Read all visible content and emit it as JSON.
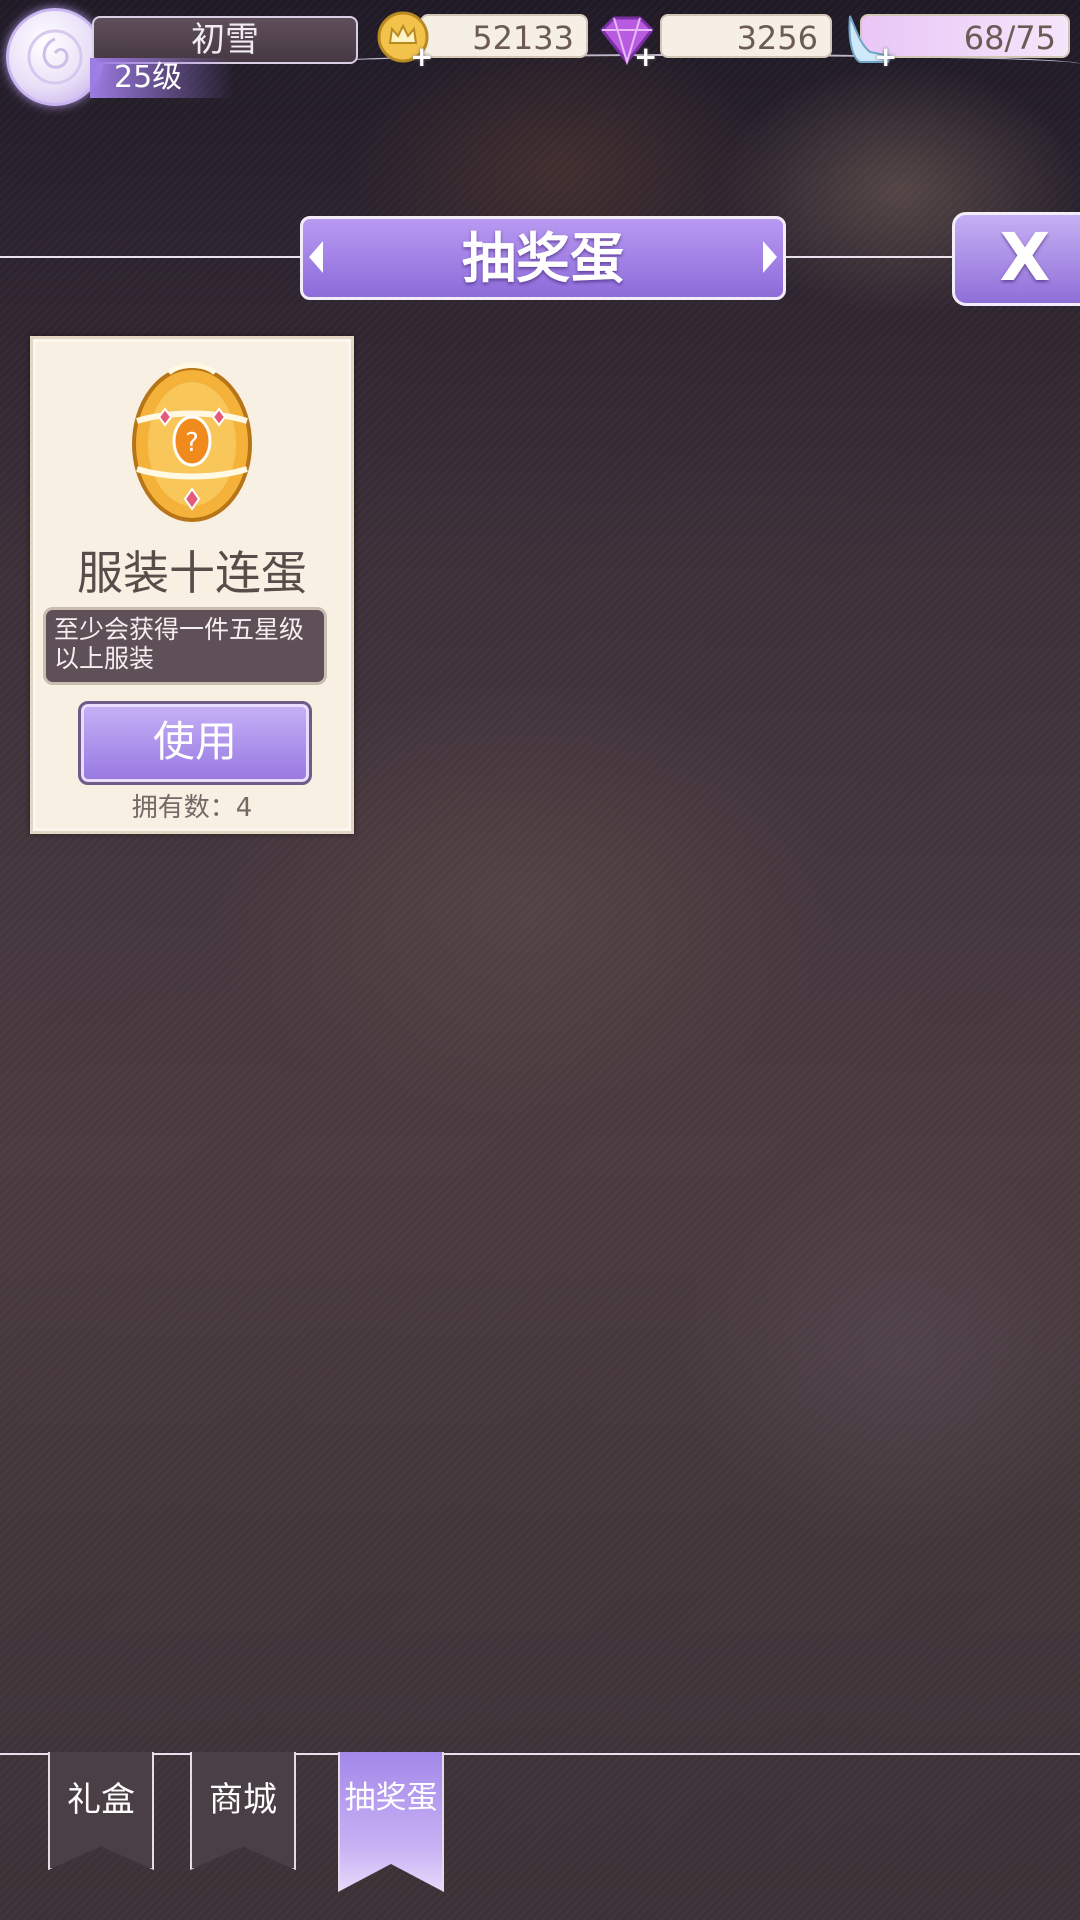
{
  "player": {
    "name": "初雪",
    "level": "25级"
  },
  "resources": {
    "gold": "52133",
    "diamonds": "3256",
    "stamina": "68/75"
  },
  "panel": {
    "title": "抽奖蛋",
    "close_label": "X"
  },
  "item_card": {
    "name": "服装十连蛋",
    "description": "至少会获得一件五星级以上服装",
    "use_label": "使用",
    "owned": "拥有数：4"
  },
  "tabs": [
    {
      "label": "礼盒",
      "active": false
    },
    {
      "label": "商城",
      "active": false
    },
    {
      "label": "抽奖蛋",
      "active": true
    }
  ],
  "colors": {
    "accent": "#9b7ce4",
    "card": "#f8f0e2"
  }
}
